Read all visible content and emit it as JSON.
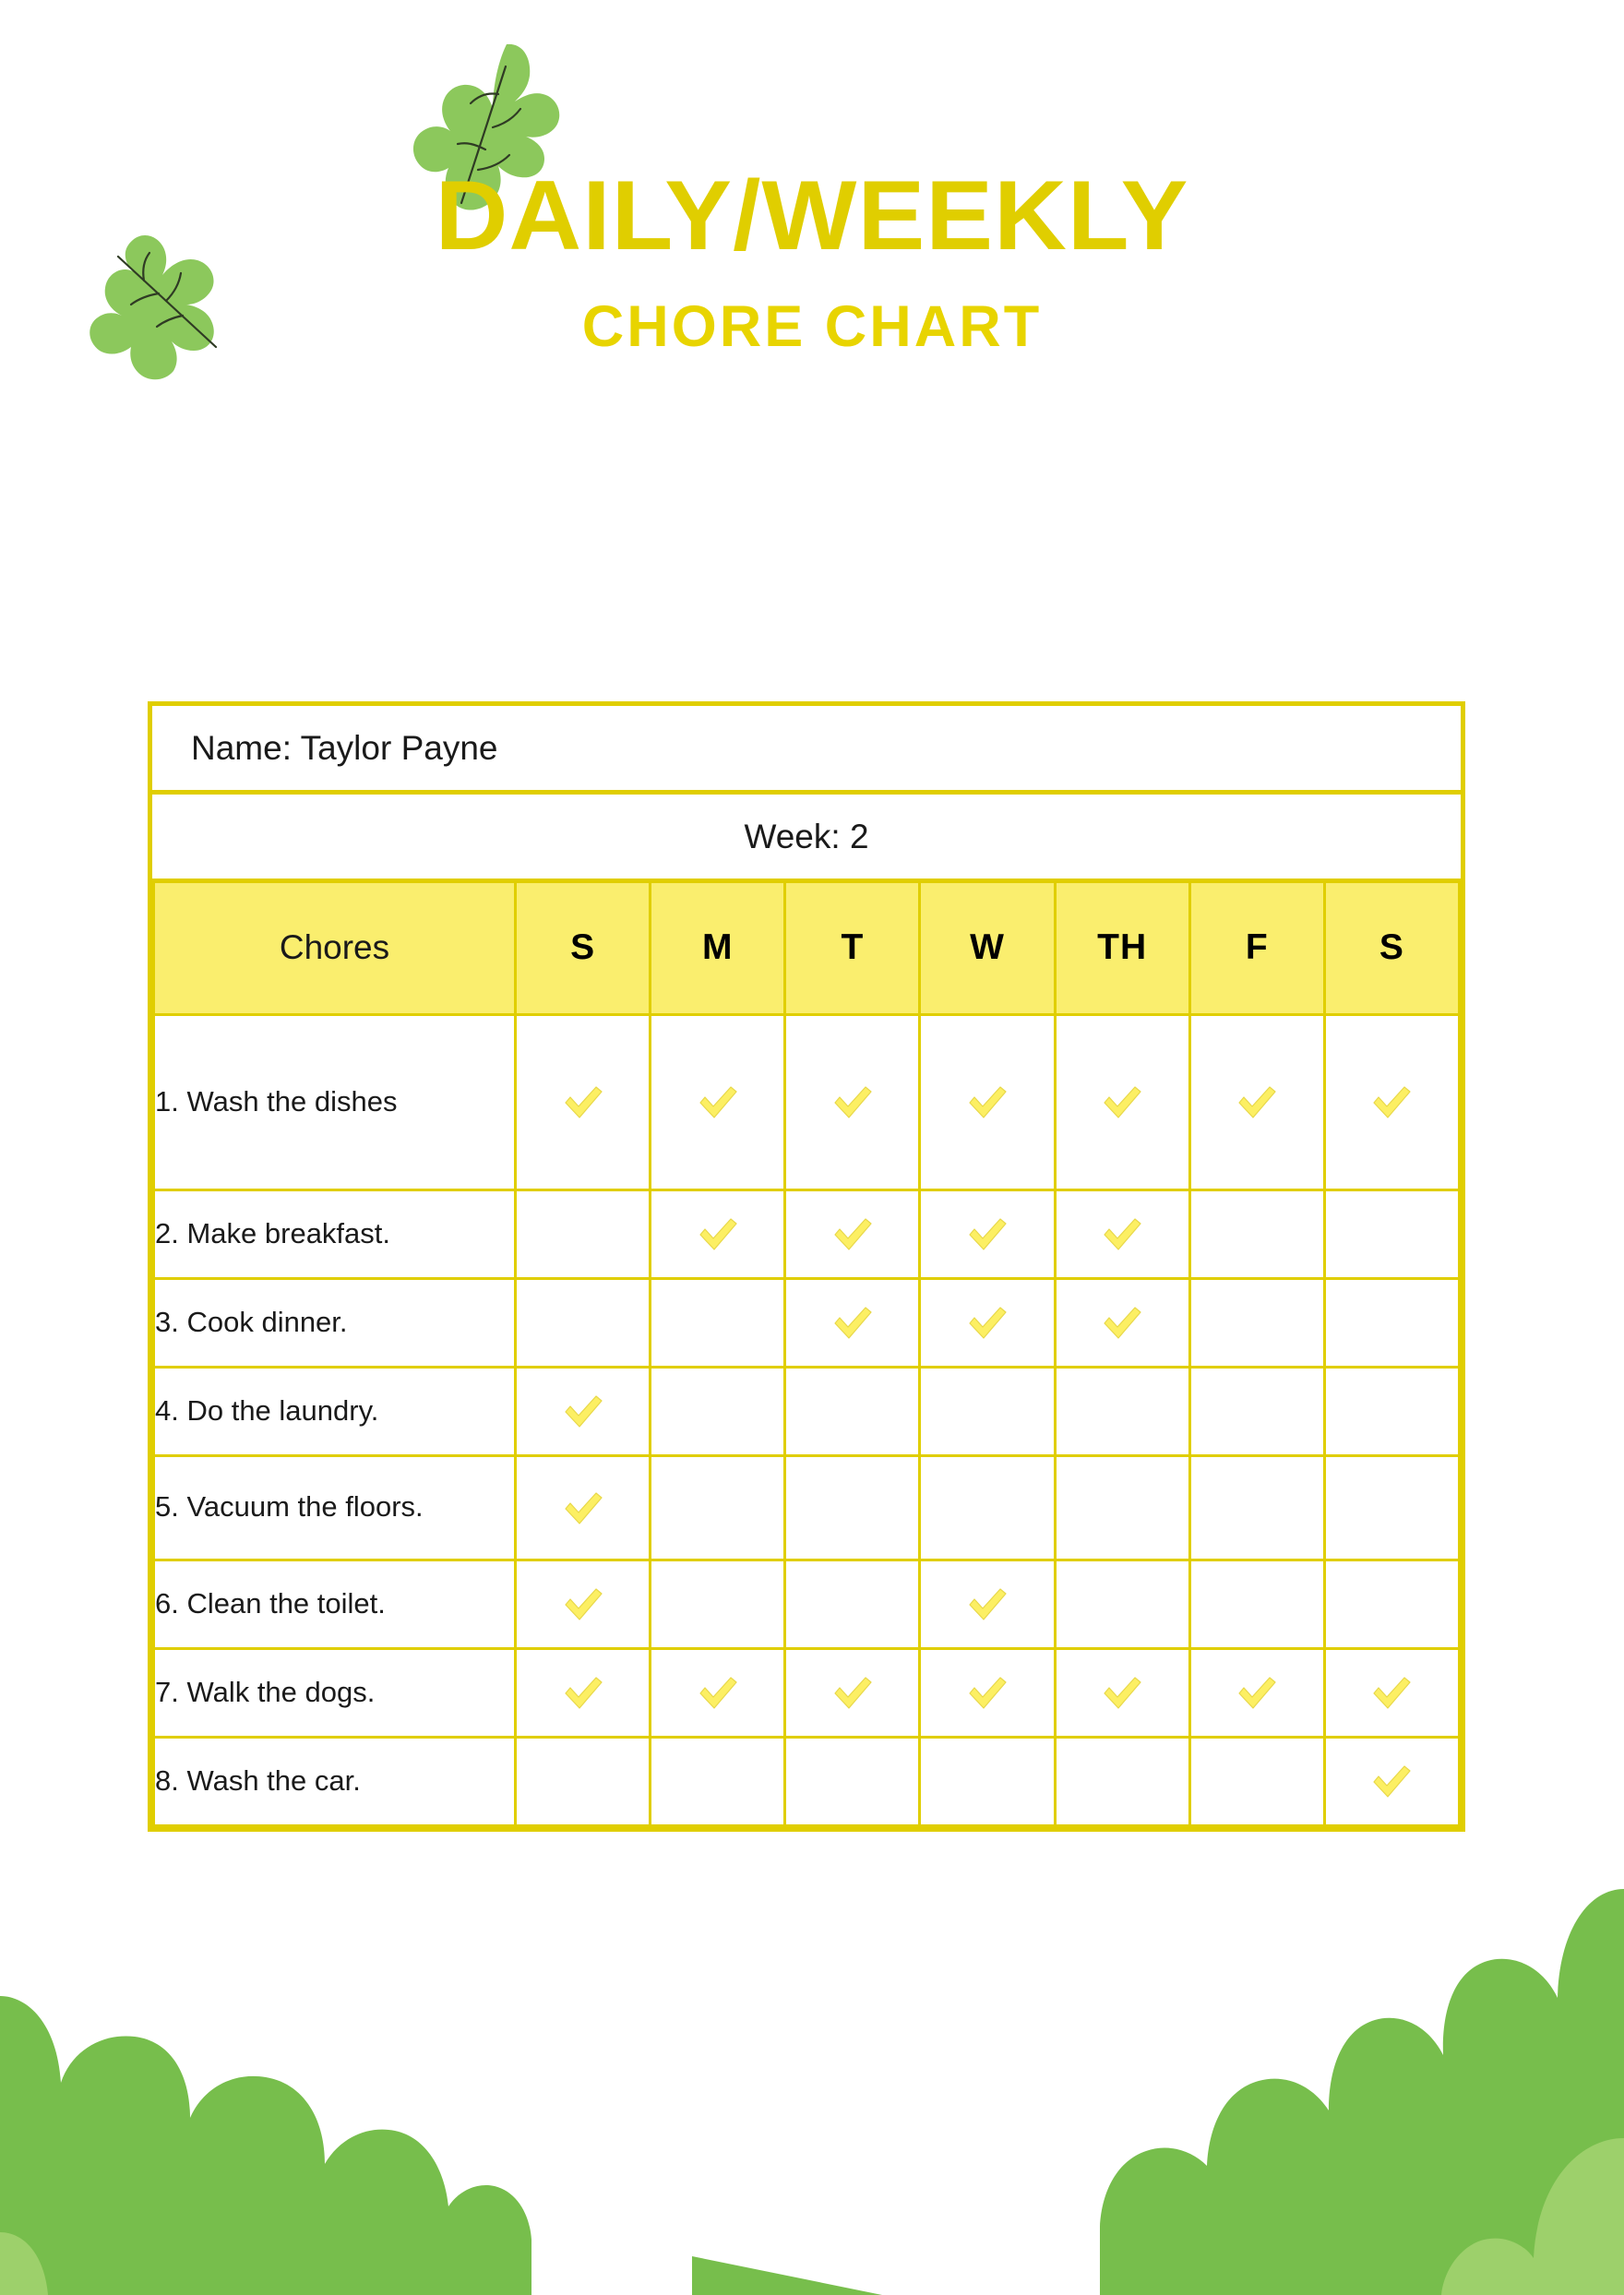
{
  "title": {
    "line1": "DAILY/WEEKLY",
    "line2": "CHORE CHART",
    "color": "#E0CE00"
  },
  "decorations": {
    "leaf_top": "leaf-icon",
    "leaf_left": "leaf-icon",
    "bush_left": "bush-shape",
    "bush_right": "bush-shape",
    "leaf_color": "#8CC85C",
    "bush_color": "#77BE4C",
    "bush_light_color": "#9DD06B"
  },
  "table": {
    "border_color": "#E0CE00",
    "header_fill": "#FAEE6E",
    "check_color": "#FCEF63",
    "name_label": "Name: Taylor Payne",
    "week_label": "Week: 2",
    "chores_header": "Chores",
    "days": [
      "S",
      "M",
      "T",
      "W",
      "TH",
      "F",
      "S"
    ],
    "rows": [
      {
        "label": "1. Wash the dishes",
        "line1": "1. Wash the dishes",
        "line2": "",
        "checks": [
          true,
          true,
          true,
          true,
          true,
          true,
          true
        ]
      },
      {
        "label": "2. Make breakfast.",
        "line1": "2. Make breakfast.",
        "line2": "",
        "checks": [
          false,
          true,
          true,
          true,
          true,
          false,
          false
        ]
      },
      {
        "label": "3. Cook dinner.",
        "line1": "3. Cook dinner.",
        "line2": "",
        "checks": [
          false,
          false,
          true,
          true,
          true,
          false,
          false
        ]
      },
      {
        "label": "4. Do the laundry.",
        "line1": "4. Do the laundry.",
        "line2": "",
        "checks": [
          true,
          false,
          false,
          false,
          false,
          false,
          false
        ]
      },
      {
        "label": "5. Vacuum the floors.",
        "line1": "5. Vacuum the",
        "line2": "floors.",
        "checks": [
          true,
          false,
          false,
          false,
          false,
          false,
          false
        ]
      },
      {
        "label": "6. Clean the toilet.",
        "line1": "6. Clean the toilet.",
        "line2": "",
        "checks": [
          true,
          false,
          false,
          true,
          false,
          false,
          false
        ]
      },
      {
        "label": "7. Walk the dogs.",
        "line1": "7. Walk the dogs.",
        "line2": "",
        "checks": [
          true,
          true,
          true,
          true,
          true,
          true,
          true
        ]
      },
      {
        "label": "8. Wash the car.",
        "line1": "8. Wash the car.",
        "line2": "",
        "checks": [
          false,
          false,
          false,
          false,
          false,
          false,
          true
        ]
      }
    ]
  }
}
